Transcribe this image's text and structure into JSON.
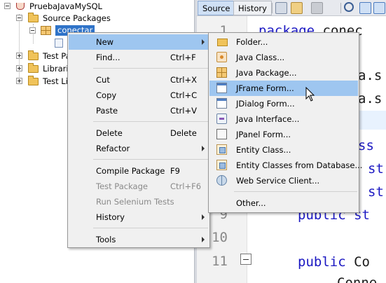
{
  "project_tree": {
    "root_label": "PruebaJavaMySQL",
    "source_packages_label": "Source Packages",
    "package_label": "conectar",
    "test_packages_label": "Test Pa",
    "libraries_label": "Librarie",
    "test_libraries_label": "Test Lib"
  },
  "editor": {
    "tabs": {
      "source": "Source",
      "history": "History"
    },
    "line_numbers": [
      "1",
      "9",
      "10",
      "11"
    ],
    "code": {
      "line1_kw": "package",
      "line1_rest": " conec",
      "import1": "a.s",
      "import2": "a.s",
      "class_frag": "ss",
      "st1": "st",
      "st2": "st",
      "line9_kw": "public",
      "line9_rest": " st",
      "line11_kw": "public",
      "line11_rest": " Co",
      "last_frag": "Conne"
    }
  },
  "context_menu": {
    "new": "New",
    "find": "Find...",
    "find_shortcut": "Ctrl+F",
    "cut": "Cut",
    "cut_shortcut": "Ctrl+X",
    "copy": "Copy",
    "copy_shortcut": "Ctrl+C",
    "paste": "Paste",
    "paste_shortcut": "Ctrl+V",
    "delete": "Delete",
    "delete_shortcut": "Delete",
    "refactor": "Refactor",
    "compile_package": "Compile Package",
    "compile_shortcut": "F9",
    "test_package": "Test Package",
    "test_shortcut": "Ctrl+F6",
    "run_selenium": "Run Selenium Tests",
    "history": "History",
    "tools": "Tools"
  },
  "new_submenu": {
    "folder": "Folder...",
    "java_class": "Java Class...",
    "java_package": "Java Package...",
    "jframe_form": "JFrame Form...",
    "jdialog_form": "JDialog Form...",
    "java_interface": "Java Interface...",
    "jpanel_form": "JPanel Form...",
    "entity_class": "Entity Class...",
    "entity_from_db": "Entity Classes from Database...",
    "web_service_client": "Web Service Client...",
    "other": "Other..."
  },
  "colors": {
    "menu_highlight": "#9ec6f0",
    "tree_selection": "#2f73c8",
    "keyword": "#1b18c2"
  },
  "icons": [
    "folder-icon",
    "java-class-icon",
    "java-package-icon",
    "jframe-form-icon",
    "jdialog-form-icon",
    "java-interface-icon",
    "jpanel-form-icon",
    "entity-class-icon",
    "entity-db-icon",
    "web-service-icon",
    "mouse-pointer-icon"
  ]
}
